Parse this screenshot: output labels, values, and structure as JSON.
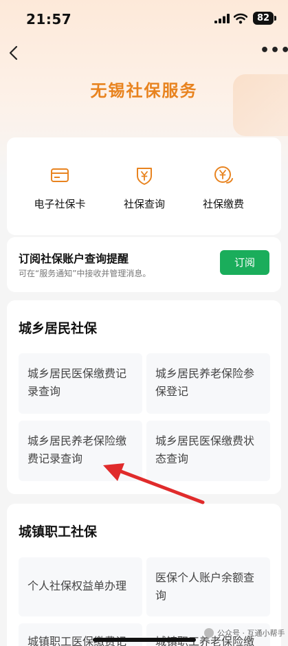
{
  "status_bar": {
    "time": "21:57",
    "battery": "82"
  },
  "header": {
    "title": "无锡社保服务"
  },
  "quick_actions": [
    {
      "label": "电子社保卡",
      "icon": "card-icon"
    },
    {
      "label": "社保查询",
      "icon": "shield-yen-icon"
    },
    {
      "label": "社保缴费",
      "icon": "yen-payment-icon"
    }
  ],
  "subscribe": {
    "title": "订阅社保账户查询提醒",
    "desc": "可在“服务通知”中接收并管理消息。",
    "button": "订阅"
  },
  "section1": {
    "title": "城乡居民社保",
    "items": [
      {
        "line1": "城乡居民医保缴费记",
        "line2": "录查询"
      },
      {
        "line1": "城乡居民养老保险参",
        "line2": "保登记"
      },
      {
        "line1": "城乡居民养老保险缴",
        "line2": "费记录查询"
      },
      {
        "line1": "城乡居民医保缴费状",
        "line2": "态查询"
      }
    ]
  },
  "section2": {
    "title": "城镇职工社保",
    "items": [
      {
        "line1": "个人社保权益单办理",
        "line2": ""
      },
      {
        "line1": "医保个人账户余额查",
        "line2": "询"
      },
      {
        "line1": "城镇职工医保缴费记",
        "line2": ""
      },
      {
        "line1": "城镇职工养老保险缴",
        "line2": ""
      }
    ]
  },
  "watermark": "公众号 · 互通小帮手",
  "colors": {
    "accent": "#e8831f",
    "subscribe_button": "#1aad5b",
    "arrow": "#e02b2b"
  }
}
